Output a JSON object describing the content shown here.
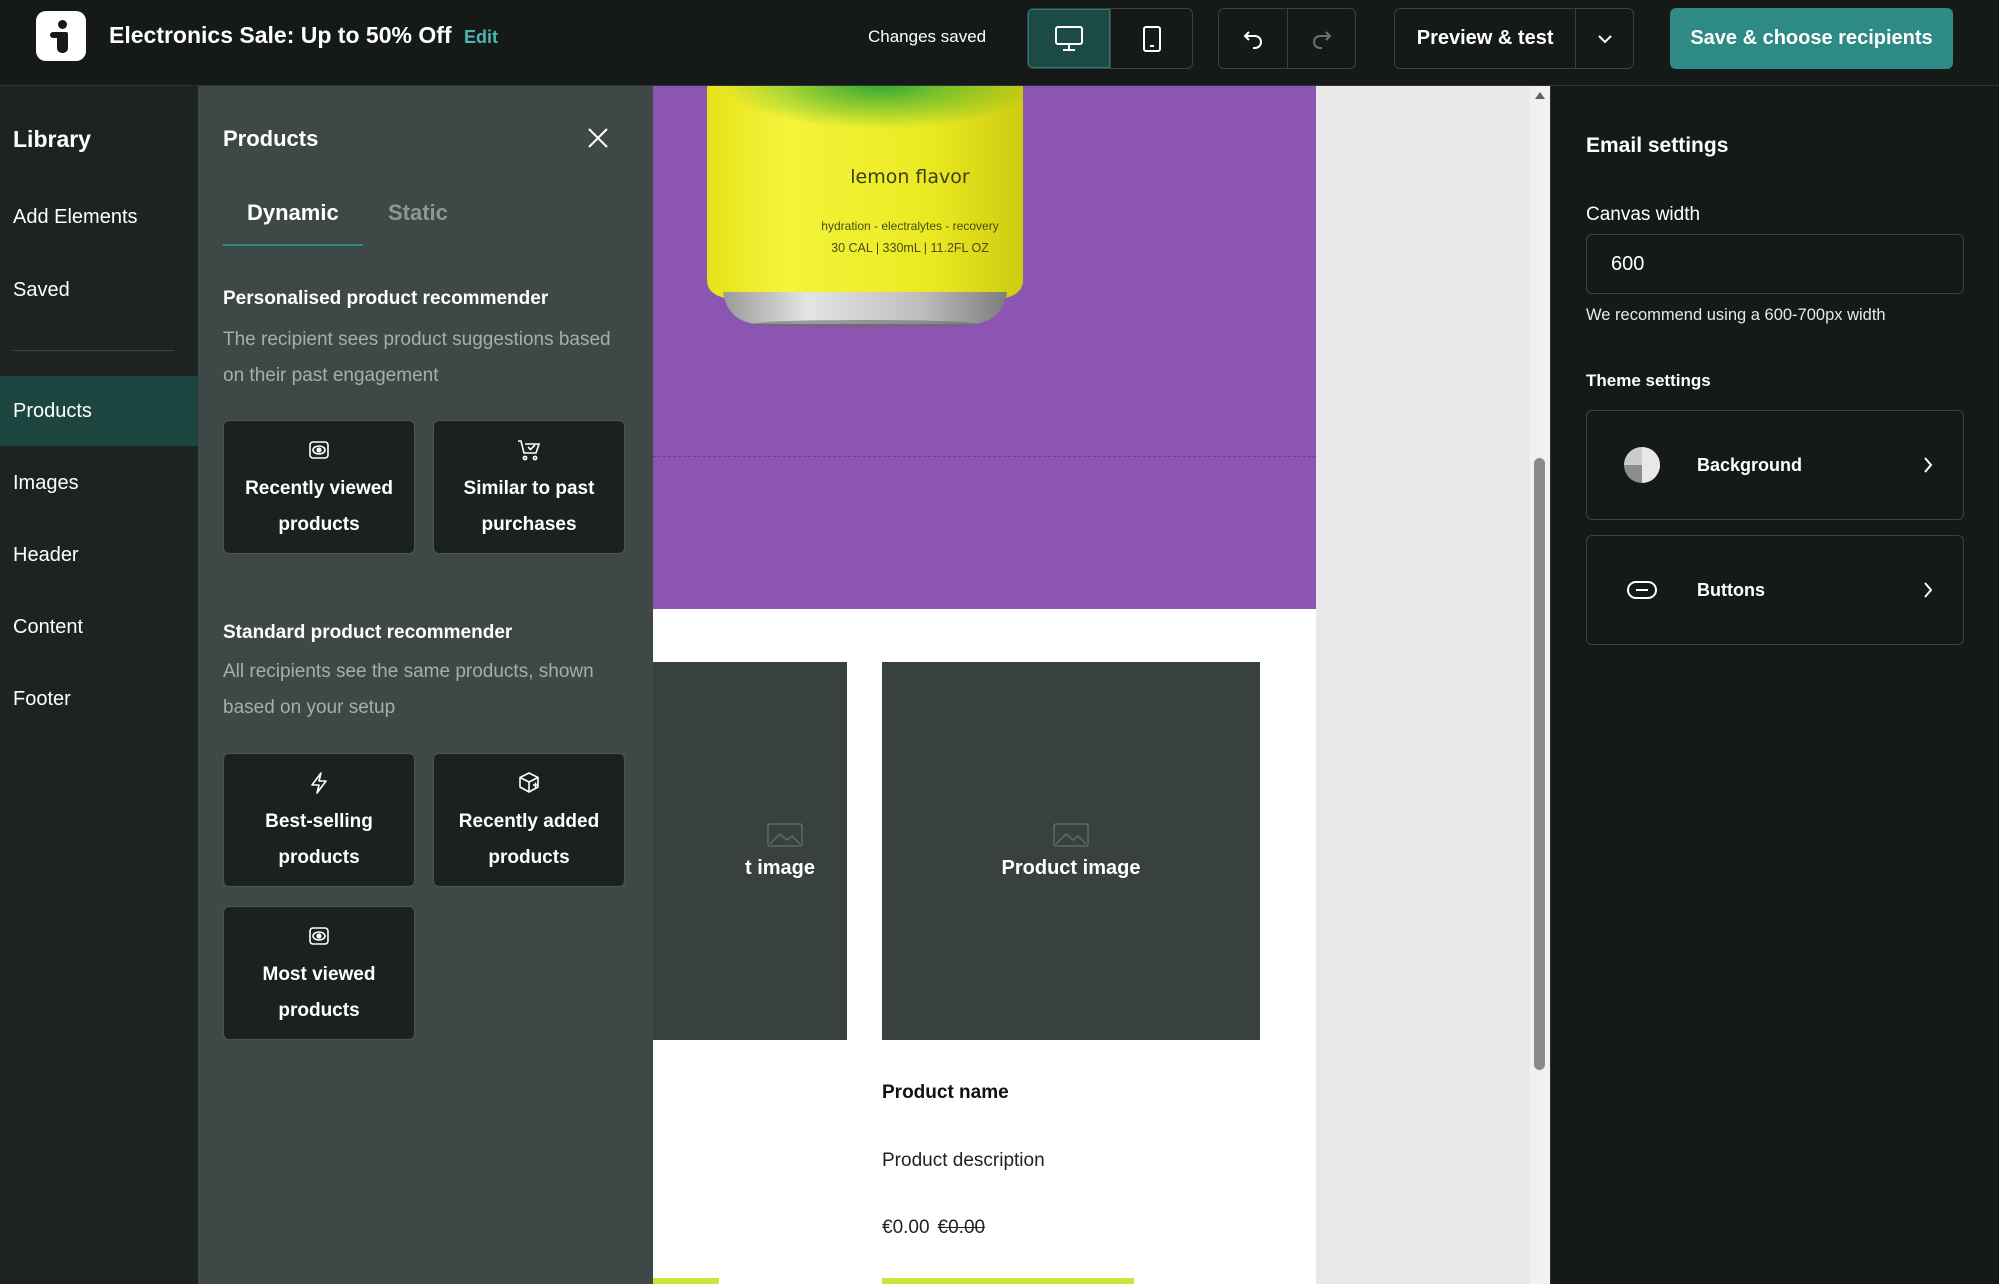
{
  "header": {
    "title": "Electronics Sale: Up to 50% Off",
    "edit_label": "Edit",
    "status": "Changes saved",
    "preview_label": "Preview & test",
    "save_label": "Save & choose recipients"
  },
  "library": {
    "title": "Library",
    "items": [
      {
        "label": "Add Elements"
      },
      {
        "label": "Saved"
      },
      {
        "label": "Products"
      },
      {
        "label": "Images"
      },
      {
        "label": "Header"
      },
      {
        "label": "Content"
      },
      {
        "label": "Footer"
      }
    ],
    "active": "Products"
  },
  "products_panel": {
    "title": "Products",
    "tabs": [
      {
        "label": "Dynamic"
      },
      {
        "label": "Static"
      }
    ],
    "active_tab": "Dynamic",
    "personalised": {
      "heading": "Personalised product recommender",
      "description": "The recipient sees product suggestions based on their past engagement",
      "cards": [
        {
          "label": "Recently viewed products",
          "icon": "eye-icon"
        },
        {
          "label": "Similar to past purchases",
          "icon": "cart-check-icon"
        }
      ]
    },
    "standard": {
      "heading": "Standard product recommender",
      "description": "All recipients see the same products, shown based on your setup",
      "cards": [
        {
          "label": "Best-selling products",
          "icon": "lightning-icon"
        },
        {
          "label": "Recently added products",
          "icon": "box-plus-icon"
        },
        {
          "label": "Most viewed products",
          "icon": "eye-icon"
        }
      ]
    }
  },
  "canvas": {
    "hero_color": "#8d55b2",
    "can_label": "lemon flavor",
    "can_sub1": "hydration - electralytes - recovery",
    "can_sub2": "30 CAL | 330mL | 11.2FL OZ",
    "product_image_left": "t image",
    "product_image": "Product image",
    "product_name": "Product name",
    "product_description": "Product description",
    "price": "€0.00",
    "old_price": "€0.00"
  },
  "settings": {
    "title": "Email settings",
    "canvas_width_label": "Canvas width",
    "canvas_width_value": "600",
    "hint": "We recommend using a 600-700px width",
    "theme_title": "Theme settings",
    "rows": [
      {
        "label": "Background",
        "icon": "half-circle-icon"
      },
      {
        "label": "Buttons",
        "icon": "button-pill-icon"
      }
    ]
  },
  "colors": {
    "accent": "#2e8a84",
    "link": "#4fb5b0",
    "lime": "#c8e63c"
  }
}
